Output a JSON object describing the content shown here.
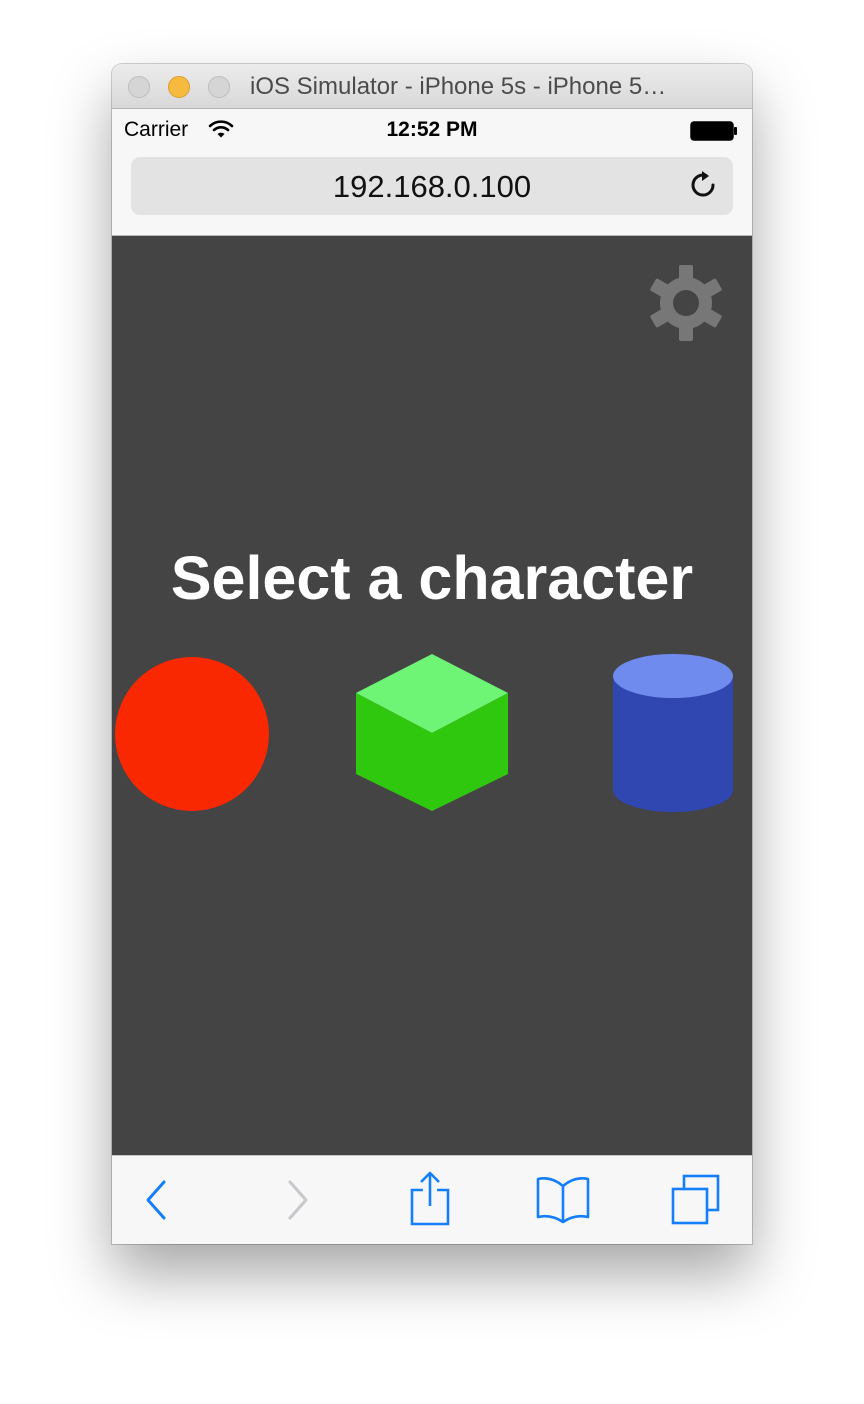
{
  "window": {
    "title": "iOS Simulator - iPhone 5s - iPhone 5…"
  },
  "status_bar": {
    "carrier": "Carrier",
    "time": "12:52 PM"
  },
  "browser": {
    "url": "192.168.0.100"
  },
  "page": {
    "heading": "Select a character",
    "characters": [
      {
        "shape": "sphere",
        "color": "#f92800"
      },
      {
        "shape": "cube",
        "top_color": "#6ef575",
        "side_color": "#30c80f"
      },
      {
        "shape": "cylinder",
        "top_color": "#6f8bee",
        "body_color": "#3046b0"
      }
    ],
    "settings_icon": "gear-icon",
    "background_color": "#444444"
  },
  "toolbar": {
    "items": [
      "back-icon",
      "forward-icon",
      "share-icon",
      "bookmarks-icon",
      "tabs-icon"
    ],
    "accent_color": "#147efb",
    "disabled_color": "#c7c7cc"
  }
}
